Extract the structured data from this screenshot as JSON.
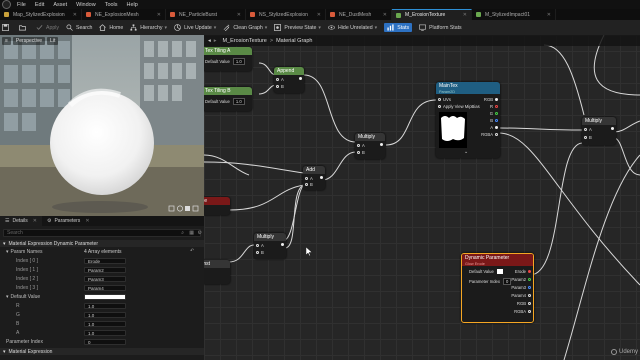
{
  "menubar": {
    "items": [
      "File",
      "Edit",
      "Asset",
      "Window",
      "Tools",
      "Help"
    ]
  },
  "tabs": [
    {
      "label": "Map_StylizedExplosion",
      "color": "#c8a03a"
    },
    {
      "label": "NE_ExplosionMesh",
      "color": "#d85a3a"
    },
    {
      "label": "NE_ParticleBurst",
      "color": "#d85a3a"
    },
    {
      "label": "NS_StylizedExplosion",
      "color": "#d85a3a"
    },
    {
      "label": "NE_DustMesh",
      "color": "#d85a3a"
    },
    {
      "label": "M_ErosionTexture",
      "color": "#6aa84f",
      "active": true
    },
    {
      "label": "M_StylizedImpact01",
      "color": "#6aa84f"
    }
  ],
  "toolbar": {
    "save": "",
    "apply": "Apply",
    "search": "Search",
    "home": "Home",
    "hierarchy": "Hierarchy",
    "live_update": "Live Update",
    "clean_graph": "Clean Graph",
    "preview_state": "Preview State",
    "hide_unrelated": "Hide Unrelated",
    "stats": "Stats",
    "platform_stats": "Platform Stats"
  },
  "viewport": {
    "mode": "Perspective",
    "lit": "Lit"
  },
  "details": {
    "tab1": "Details",
    "tab2": "Parameters",
    "search_placeholder": "Search",
    "category1": "Material Expression Dynamic Parameter",
    "param_names_label": "Param Names",
    "param_names_value": "4 Array elements",
    "indices": [
      {
        "label": "Index [ 0 ]",
        "value": "Erode"
      },
      {
        "label": "Index [ 1 ]",
        "value": "Param2"
      },
      {
        "label": "Index [ 2 ]",
        "value": "Param3"
      },
      {
        "label": "Index [ 3 ]",
        "value": "Param4"
      }
    ],
    "default_value_label": "Default Value",
    "rgba": [
      {
        "label": "R",
        "value": "1.0"
      },
      {
        "label": "G",
        "value": "1.0"
      },
      {
        "label": "B",
        "value": "1.0"
      },
      {
        "label": "A",
        "value": "1.0"
      }
    ],
    "param_index_label": "Parameter Index",
    "param_index_value": "0",
    "category2": "Material Expression"
  },
  "graph": {
    "breadcrumb_asset": "M_ErosionTexture",
    "breadcrumb_sep": ">",
    "breadcrumb_page": "Material Graph"
  },
  "nodes": {
    "tex_tiling_a": {
      "title": "Tex Tiling A",
      "default_label": "Default Value",
      "default_value": "1.0"
    },
    "tex_tiling_b": {
      "title": "Tex Tiling B",
      "default_label": "Default Value",
      "default_value": "1.0"
    },
    "append": {
      "title": "Append",
      "a": "A",
      "b": "B"
    },
    "multiply1": {
      "title": "Multiply",
      "a": "A",
      "b": "B"
    },
    "add": {
      "title": "Add",
      "a": "A",
      "b": "B"
    },
    "multiply2": {
      "title": "Multiply",
      "a": "A",
      "b": "B"
    },
    "multiply3": {
      "title": "Multiply",
      "a": "A",
      "b": "B"
    },
    "maintex": {
      "title": "MainTex",
      "subtitle": "Param2D",
      "uvs": "UVs",
      "mipbias": "Apply View MipBias",
      "rgb": "RGB",
      "r": "R",
      "g": "G",
      "b": "B",
      "a": "A",
      "rgba": "RGBA"
    },
    "dynparam": {
      "title": "Dynamic Parameter",
      "subtitle": "Glow Erode",
      "default_value": "Default Value",
      "param_index": "Parameter Index",
      "param_index_value": "0",
      "erode": "Erode",
      "param2": "Param2",
      "param3": "Param3",
      "param4": "Param4",
      "rgb": "RGB",
      "rgba": "RGBA"
    },
    "edge_left1": {
      "title": "Side"
    },
    "edge_left2": {
      "title": "Const"
    }
  },
  "watermark": "Udemy",
  "colors": {
    "accent": "#2d8fd5",
    "selected_node": "#f5a623",
    "material_green": "#6aa84f"
  }
}
